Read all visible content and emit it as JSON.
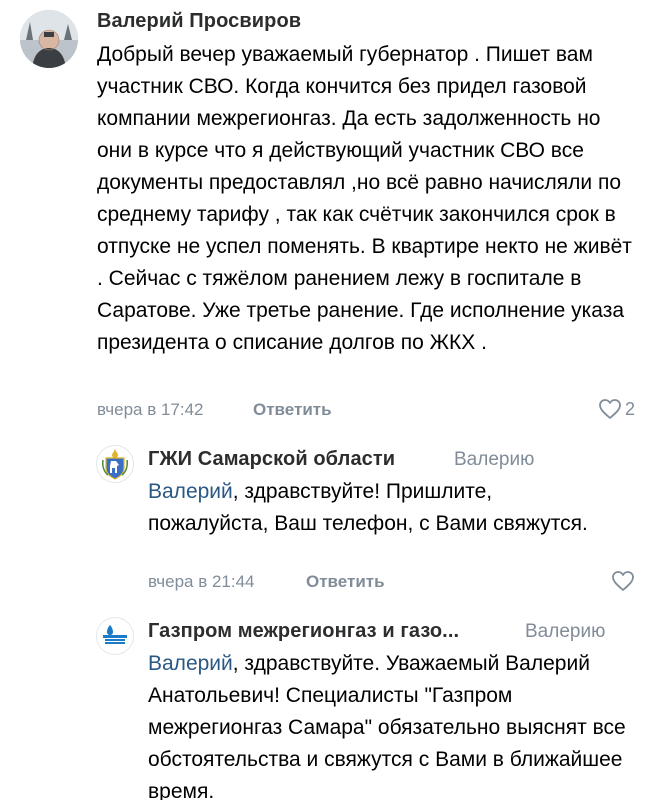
{
  "comments": [
    {
      "author": "Валерий Просвиров",
      "text": "Добрый вечер  уважаемый губернатор . Пишет вам участник СВО. Когда кончится без придел газовой компании межрегионгаз. Да есть задолженность но они в курсе что я действующий участник СВО все документы предоставлял ,но всё равно начисляли по среднему тарифу , так как счётчик закончился срок в отпуске не успел поменять. В квартире некто не живёт . Сейчас с тяжёлом ранением лежу в госпитале в Саратове. Уже третье ранение. Где исполнение указа президента о списание долгов по ЖКХ .",
      "time": "вчера в 17:42",
      "reply_label": "Ответить",
      "likes": "2"
    }
  ],
  "replies": [
    {
      "author": "ГЖИ Самарской области",
      "reply_to": "Валерию",
      "mention": "Валерий",
      "text": ", здравствуйте! Пришлите, пожалуйста, Ваш телефон, с Вами свяжутся.",
      "time": "вчера в 21:44",
      "reply_label": "Ответить"
    },
    {
      "author": "Газпром межрегионгаз и газо...",
      "reply_to": "Валерию",
      "mention": "Валерий",
      "text": ", здравствуйте. Уважаемый Валерий Анатольевич! Специалисты \"Газпром межрегионгаз Самара\" обязательно выяснят все обстоятельства и свяжутся с Вами в ближайшее время."
    }
  ],
  "icons": {
    "like": "heart-icon",
    "avatar_1": "user-photo",
    "avatar_2": "samara-coat-of-arms",
    "avatar_3": "gazprom-logo"
  },
  "colors": {
    "link": "#2a5885",
    "secondary": "#818c99"
  }
}
